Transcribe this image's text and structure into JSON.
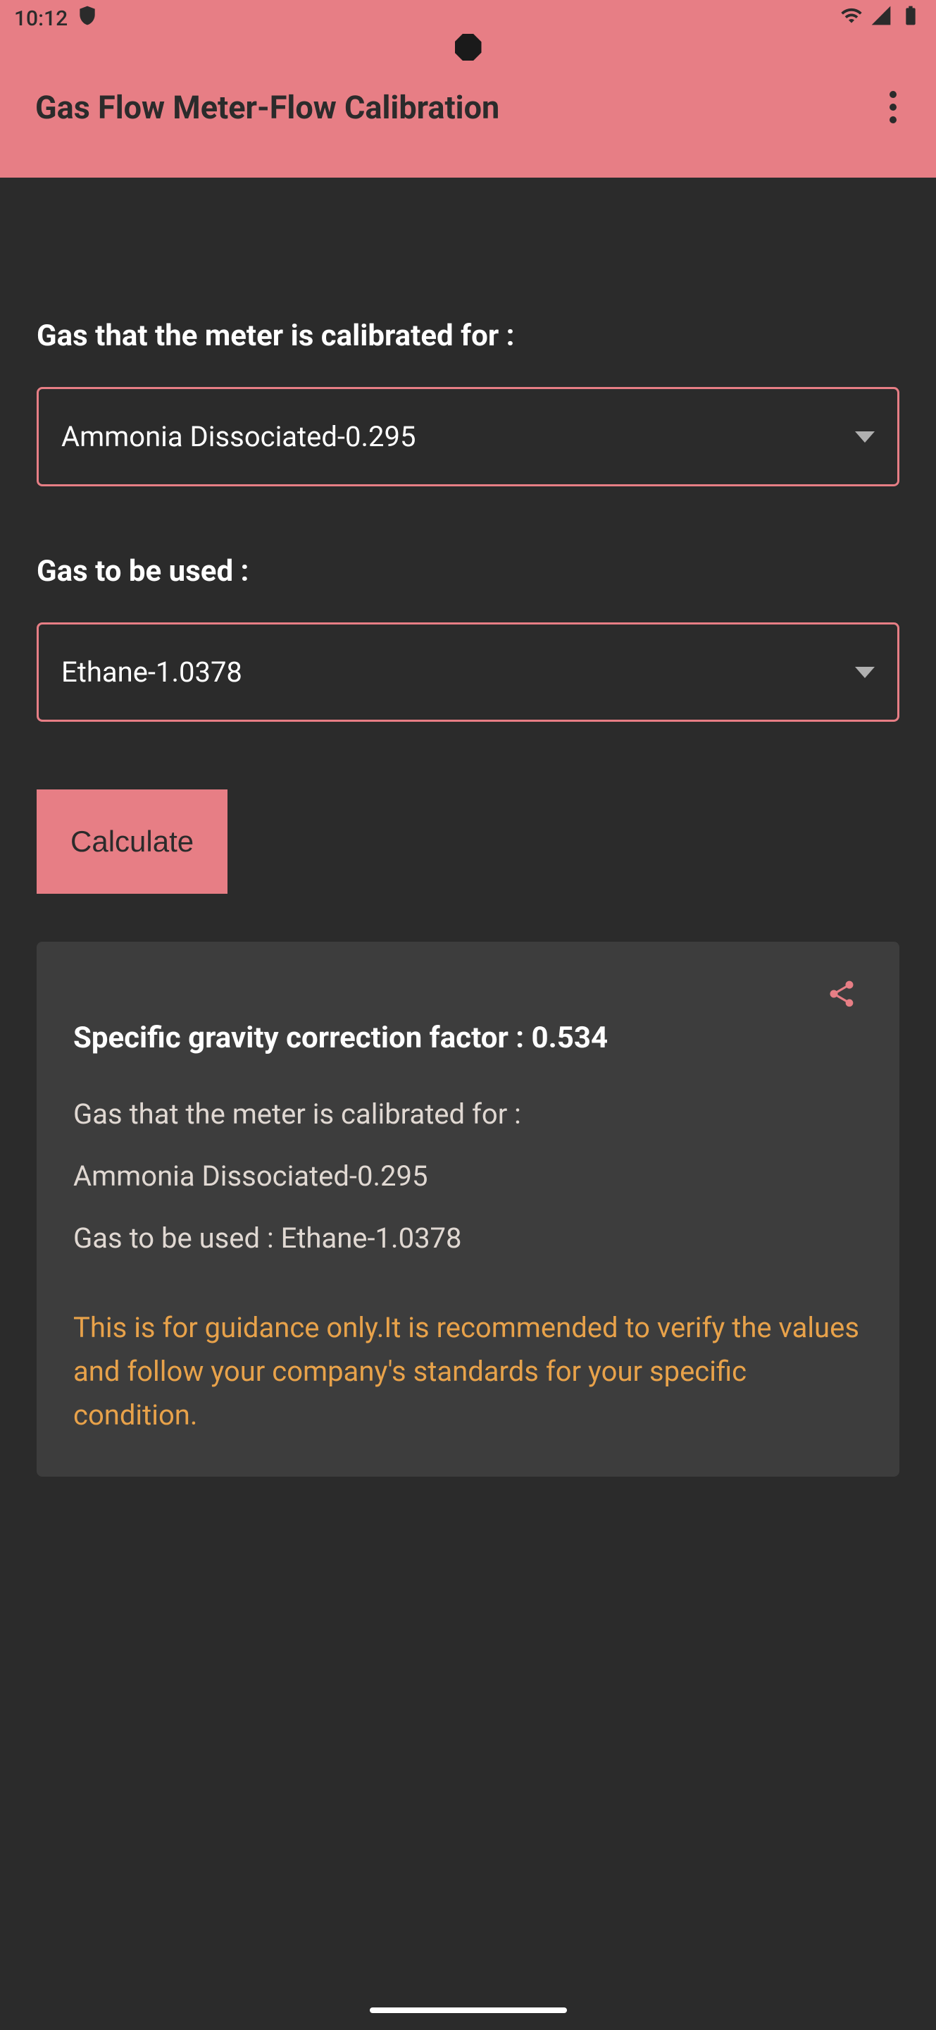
{
  "statusBar": {
    "time": "10:12"
  },
  "appBar": {
    "title": "Gas Flow Meter-Flow Calibration"
  },
  "form": {
    "calibratedGasLabel": "Gas that the meter is calibrated for :",
    "calibratedGasValue": "Ammonia Dissociated-0.295",
    "usedGasLabel": "Gas to be used :",
    "usedGasValue": "Ethane-1.0378",
    "calculateLabel": "Calculate"
  },
  "result": {
    "title": "Specific gravity correction factor : 0.534",
    "line1": "Gas that the meter is calibrated for :",
    "line2": "Ammonia Dissociated-0.295",
    "line3": "Gas to be used : Ethane-1.0378",
    "disclaimer": "This is for guidance only.It is recommended to verify the values and follow your company's standards for your specific condition."
  }
}
